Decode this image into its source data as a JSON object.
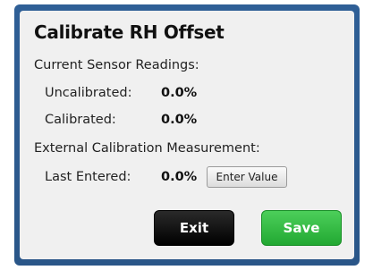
{
  "dialog": {
    "title": "Calibrate RH Offset",
    "current_heading": "Current Sensor Readings:",
    "uncalibrated_label": "Uncalibrated:",
    "uncalibrated_value": "0.0%",
    "calibrated_label": "Calibrated:",
    "calibrated_value": "0.0%",
    "external_heading": "External Calibration Measurement:",
    "last_entered_label": "Last Entered:",
    "last_entered_value": "0.0%",
    "enter_value_label": "Enter Value",
    "exit_label": "Exit",
    "save_label": "Save"
  },
  "colors": {
    "frame": "#2f5f96",
    "panel": "#f0f0f0",
    "exit": "#000000",
    "save": "#2dbb3d"
  }
}
